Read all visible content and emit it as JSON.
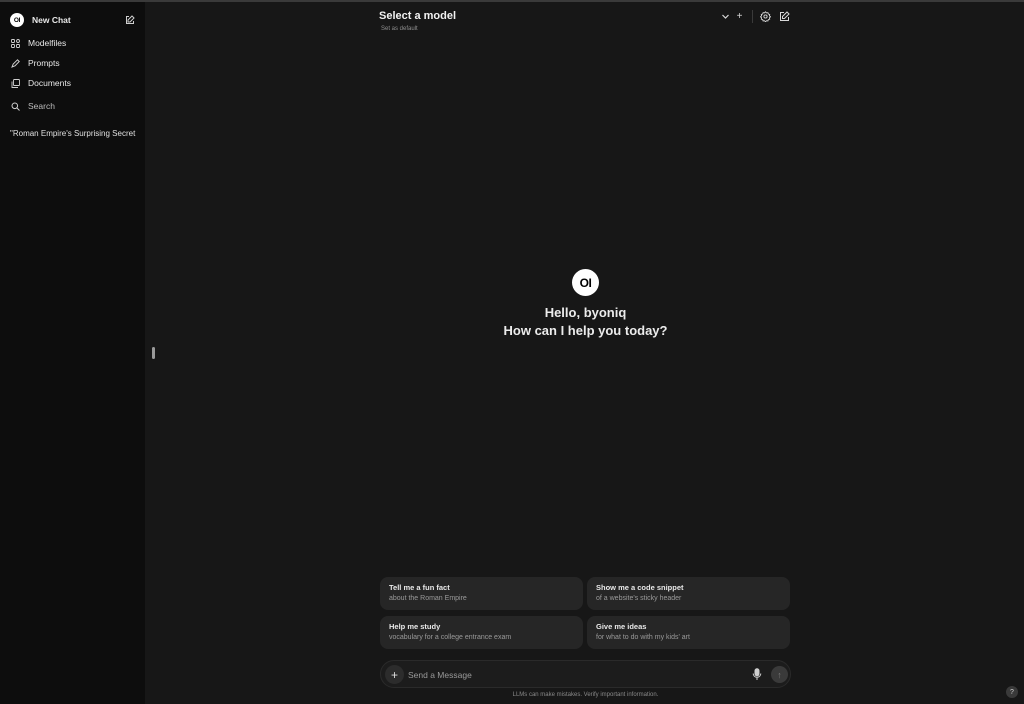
{
  "sidebar": {
    "logo_text": "OI",
    "new_chat_label": "New Chat",
    "nav": [
      {
        "label": "Modelfiles",
        "icon": "modelfiles-icon"
      },
      {
        "label": "Prompts",
        "icon": "pencil-icon"
      },
      {
        "label": "Documents",
        "icon": "documents-icon"
      }
    ],
    "search_label": "Search",
    "chats": [
      "\"Roman Empire's Surprising Secret"
    ]
  },
  "header": {
    "model_selector": "Select a model",
    "set_default": "Set as default",
    "plus_symbol": "+"
  },
  "greeting": {
    "logo_text": "OI",
    "line1": "Hello, byoniq",
    "line2": "How can I help you today?"
  },
  "suggestions": [
    {
      "title": "Tell me a fun fact",
      "subtitle": "about the Roman Empire"
    },
    {
      "title": "Show me a code snippet",
      "subtitle": "of a website's sticky header"
    },
    {
      "title": "Help me study",
      "subtitle": "vocabulary for a college entrance exam"
    },
    {
      "title": "Give me ideas",
      "subtitle": "for what to do with my kids' art"
    }
  ],
  "composer": {
    "placeholder": "Send a Message",
    "plus_symbol": "+",
    "send_symbol": "↑"
  },
  "disclaimer": "LLMs can make mistakes. Verify important information.",
  "help_symbol": "?"
}
